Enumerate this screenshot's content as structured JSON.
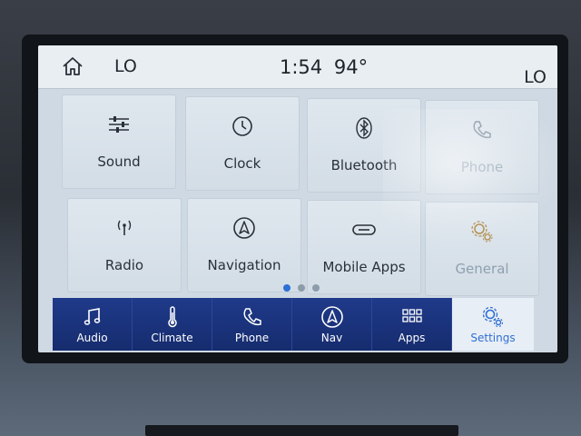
{
  "status": {
    "home_icon": "home-icon",
    "left_temp": "LO",
    "time": "1:54",
    "outside_temp": "94°",
    "right_temp": "LO"
  },
  "tiles": [
    {
      "label": "Sound",
      "icon": "sliders-icon"
    },
    {
      "label": "Clock",
      "icon": "clock-icon"
    },
    {
      "label": "Bluetooth",
      "icon": "bluetooth-icon"
    },
    {
      "label": "Phone",
      "icon": "phone-icon"
    },
    {
      "label": "Radio",
      "icon": "radio-antenna-icon"
    },
    {
      "label": "Navigation",
      "icon": "navigation-icon"
    },
    {
      "label": "Mobile Apps",
      "icon": "mobile-apps-icon"
    },
    {
      "label": "General",
      "icon": "gears-icon"
    }
  ],
  "pager": {
    "pages": 3,
    "active": 1
  },
  "nav": [
    {
      "label": "Audio",
      "icon": "music-note-icon"
    },
    {
      "label": "Climate",
      "icon": "thermometer-icon"
    },
    {
      "label": "Phone",
      "icon": "phone-icon"
    },
    {
      "label": "Nav",
      "icon": "navigation-icon"
    },
    {
      "label": "Apps",
      "icon": "apps-grid-icon"
    },
    {
      "label": "Settings",
      "icon": "gears-icon",
      "active": true
    }
  ],
  "colors": {
    "accent": "#2f6fd4",
    "navbar": "#1f3a8a",
    "screen": "#cfd9e3"
  }
}
